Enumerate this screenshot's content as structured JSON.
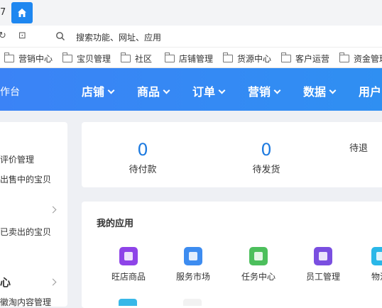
{
  "browser": {
    "tab_number": "7",
    "search_placeholder": "搜索功能、网址、应用",
    "bookmarks": [
      "营销中心",
      "宝贝管理",
      "社区",
      "店铺管理",
      "货源中心",
      "客户运营",
      "资金管理"
    ]
  },
  "header": {
    "workbench_label": "作台",
    "nav": [
      "店铺",
      "商品",
      "订单",
      "营销",
      "数据",
      "用户"
    ]
  },
  "sidebar": {
    "items": [
      "评价管理",
      "出售中的宝贝",
      "已卖出的宝贝",
      "心",
      "徽淘内容管理"
    ]
  },
  "stats": [
    {
      "value": "0",
      "label": "待付款"
    },
    {
      "value": "0",
      "label": "待发货"
    },
    {
      "value": "",
      "label": "待退"
    }
  ],
  "apps": {
    "title": "我的应用",
    "items": [
      {
        "name": "旺店商品",
        "color": "#8e44e8"
      },
      {
        "name": "服务市场",
        "color": "#3d8cf0"
      },
      {
        "name": "任务中心",
        "color": "#4cbf5c"
      },
      {
        "name": "员工管理",
        "color": "#7a4fe0"
      },
      {
        "name": "物流",
        "color": "#2ab7e8"
      }
    ]
  },
  "colors": {
    "accent": "#1e87f0",
    "nav_bg": "#3b83f6",
    "stat_value": "#1e7be0"
  }
}
